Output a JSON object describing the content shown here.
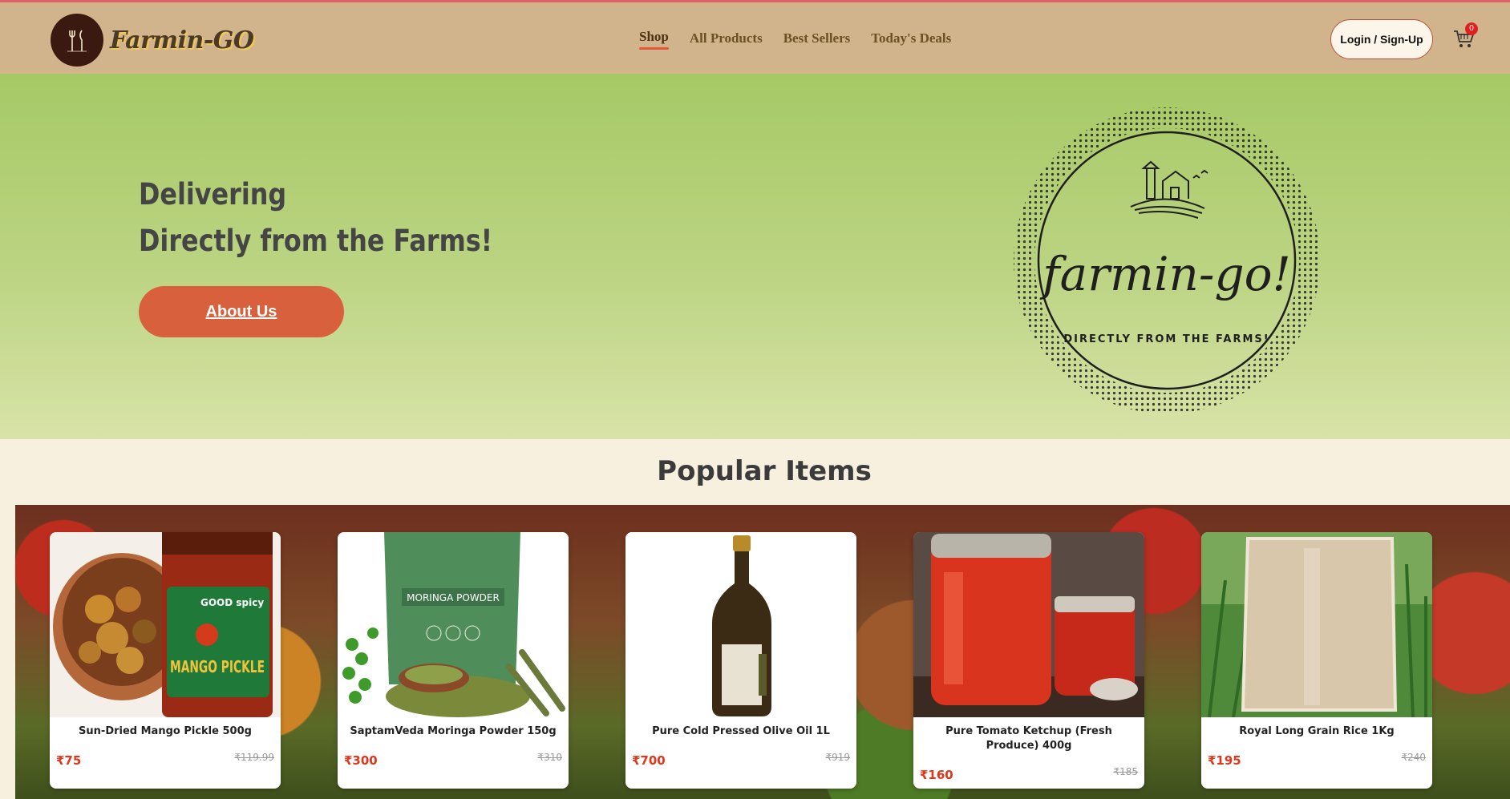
{
  "brand": {
    "name": "Farmin-GO",
    "logo_text": "farmin-go!"
  },
  "nav": {
    "links": [
      {
        "label": "Shop",
        "active": true
      },
      {
        "label": "All Products",
        "active": false
      },
      {
        "label": "Best Sellers",
        "active": false
      },
      {
        "label": "Today's Deals",
        "active": false
      }
    ],
    "login_label": "Login / Sign-Up",
    "cart_icon": "cart-icon",
    "cart_count": "0"
  },
  "hero": {
    "line1": "Delivering",
    "line2": "Directly from the Farms!",
    "button_label": "About Us",
    "logo_script": "farmin-go!",
    "logo_tagline": "DIRECTLY FROM THE FARMS!",
    "background_color": "#a6c965"
  },
  "popular": {
    "title": "Popular Items",
    "items": [
      {
        "name": "Sun-Dried Mango Pickle 500g",
        "price": "₹75",
        "old_price": "₹119.99"
      },
      {
        "name": "SaptamVeda Moringa Powder 150g",
        "price": "₹300",
        "old_price": "₹310"
      },
      {
        "name": "Pure Cold Pressed Olive Oil 1L",
        "price": "₹700",
        "old_price": "₹919"
      },
      {
        "name": "Pure Tomato Ketchup (Fresh Produce) 400g",
        "price": "₹160",
        "old_price": "₹185"
      },
      {
        "name": "Royal Long Grain Rice 1Kg",
        "price": "₹195",
        "old_price": "₹240"
      }
    ],
    "image_labels": {
      "pickle_brand": "GOOD spicy",
      "pickle_title": "MANGO PICKLE",
      "moringa_title": "MORINGA POWDER"
    }
  },
  "colors": {
    "navbar": "#d2b48c",
    "accent": "#d9603d",
    "price": "#e0361a",
    "cart_badge": "#e0201e"
  }
}
